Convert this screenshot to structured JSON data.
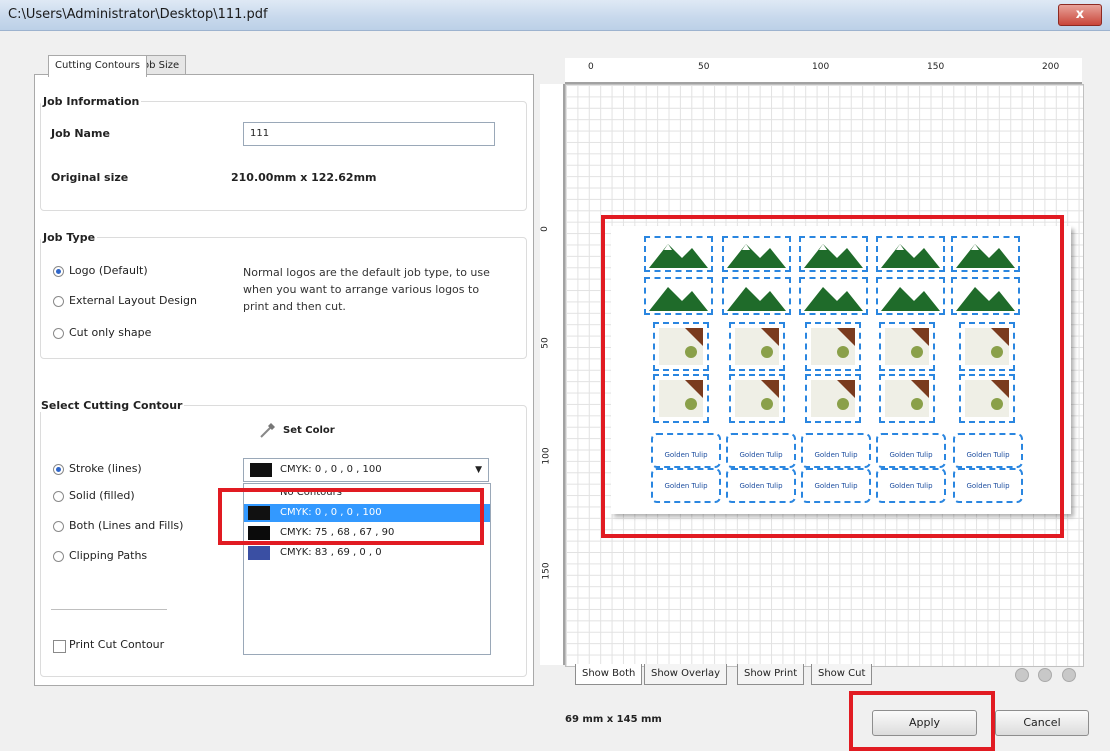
{
  "window": {
    "title": "C:\\Users\\Administrator\\Desktop\\111.pdf",
    "close_label": "x"
  },
  "tabs": [
    {
      "label": "Cutting Contours"
    },
    {
      "label": "Job Size"
    }
  ],
  "job_info": {
    "title": "Job Information",
    "name_label": "Job Name",
    "name_value": "111",
    "size_label": "Original size",
    "size_value": "210.00mm x 122.62mm"
  },
  "job_type": {
    "title": "Job Type",
    "options": [
      {
        "label": "Logo (Default)",
        "selected": true
      },
      {
        "label": "External Layout Design",
        "selected": false
      },
      {
        "label": "Cut only shape",
        "selected": false
      }
    ],
    "description": "Normal logos are the default job type, to use when you want to arrange various logos to print and then cut."
  },
  "cutting": {
    "title": "Select Cutting Contour",
    "options": [
      {
        "label": "Stroke (lines)",
        "selected": true
      },
      {
        "label": "Solid (filled)",
        "selected": false
      },
      {
        "label": "Both (Lines and Fills)",
        "selected": false
      },
      {
        "label": "Clipping Paths",
        "selected": false
      }
    ],
    "set_color_label": "Set Color",
    "selected_color": "CMYK: 0 , 0 , 0 , 100",
    "list_items": [
      {
        "label": "No Contours",
        "swatch": ""
      },
      {
        "label": "CMYK: 0 , 0 , 0 , 100",
        "swatch": "#111111"
      },
      {
        "label": "CMYK: 75 , 68 , 67 , 90",
        "swatch": "#0b0b0b"
      },
      {
        "label": "CMYK: 83 , 69 , 0 , 0",
        "swatch": "#3a4fa3"
      }
    ],
    "print_cut_label": "Print Cut Contour"
  },
  "ruler": {
    "top_ticks": [
      "0",
      "50",
      "100",
      "150",
      "200"
    ],
    "left_ticks": [
      "0",
      "50",
      "100",
      "150"
    ]
  },
  "preview": {
    "label_text": "Golden Tulip"
  },
  "view_tabs": [
    "Show Both",
    "Show Overlay",
    "Show Print",
    "Show Cut"
  ],
  "footer": {
    "dimensions": "69 mm x 145 mm",
    "apply_label": "Apply",
    "cancel_label": "Cancel"
  },
  "colors": {
    "accent_red": "#e11b22",
    "cut_blue": "#2a86e0",
    "selected_row": "#3399ff"
  }
}
